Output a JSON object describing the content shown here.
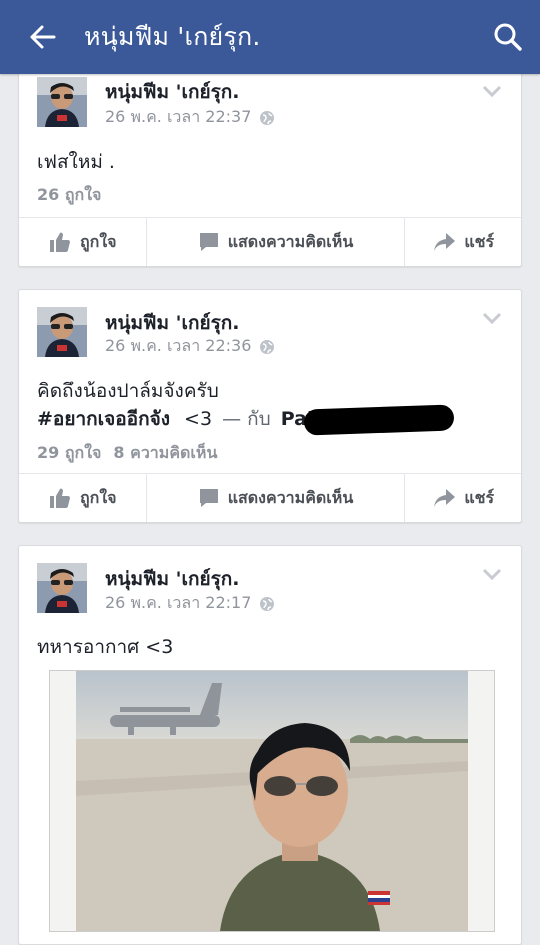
{
  "header": {
    "title": "หนุ่มฟีม 'เกย์รุก.",
    "back_icon": "back-arrow-icon",
    "search_icon": "search-icon",
    "bg_color": "#3b5998"
  },
  "posts": [
    {
      "author": "หนุ่มฟีม 'เกย์รุก.",
      "time": "26 พ.ค. เวลา 22:37",
      "text": "เฟสใหม่ .",
      "likes": "26 ถูกใจ"
    },
    {
      "author": "หนุ่มฟีม 'เกย์รุก.",
      "time": "26 พ.ค. เวลา 22:36",
      "line1": "คิดถึงน้องปาล์มจังครับ",
      "hashtag": "#อยากเจออีกจัง",
      "heart": "<3",
      "with": "— กับ",
      "tagged": "Pal",
      "likes": "29 ถูกใจ",
      "comments": "8 ความคิดเห็น"
    },
    {
      "author": "หนุ่มฟีม 'เกย์รุก.",
      "time": "26 พ.ค. เวลา 22:17",
      "text": "ทหารอากาศ <3"
    }
  ],
  "actions": {
    "like": "ถูกใจ",
    "comment": "แสดงความคิดเห็น",
    "share": "แชร์"
  }
}
